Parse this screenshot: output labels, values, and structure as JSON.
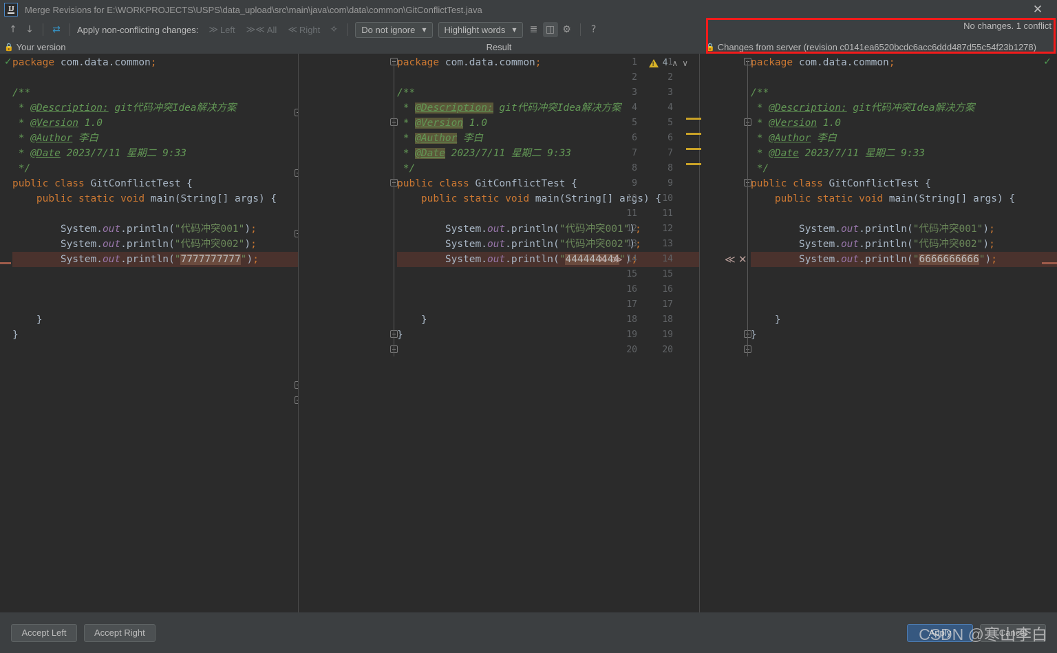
{
  "window": {
    "title": "Merge Revisions for E:\\WORKPROJECTS\\USPS\\data_upload\\src\\main\\java\\com\\data\\common\\GitConflictTest.java",
    "logo_text": "IJ",
    "close_label": "✕"
  },
  "toolbar": {
    "prev_label": "↑",
    "next_label": "↓",
    "magic_label": "⇄",
    "apply_label": "Apply non-conflicting changes:",
    "apply_left": "Left",
    "apply_all": "All",
    "apply_right": "Right",
    "magic_resolve_label": "✨",
    "ignore_combo": "Do not ignore",
    "highlight_combo": "Highlight words",
    "collapse_icon": "≡",
    "columns_icon": "▥",
    "gear_icon": "⚙",
    "help_icon": "?"
  },
  "panes": {
    "left_title": "Your version",
    "center_title": "Result",
    "right_title": "Changes from server (revision c0141ea6520bcdc6acc6ddd487d55c54f23b1278)",
    "lock_glyph": "🔒",
    "status": "No changes. 1 conflict",
    "warning_count": "4",
    "warn_up": "∧",
    "warn_down": "∨",
    "check_glyph": "✓"
  },
  "conflict": {
    "left_reject": "✕",
    "left_accept": "≫",
    "right_accept": "≪",
    "right_reject": "✕"
  },
  "code": {
    "left_lines": [
      {
        "n": 1,
        "tokens": [
          [
            "kw",
            "package"
          ],
          [
            "plain",
            " com.data.common"
          ],
          [
            "semi",
            ";"
          ]
        ]
      },
      {
        "n": 2,
        "tokens": []
      },
      {
        "n": 3,
        "tokens": [
          [
            "cmt",
            "/**"
          ]
        ]
      },
      {
        "n": 4,
        "tokens": [
          [
            "cmt",
            " * "
          ],
          [
            "tag",
            "@Description:"
          ],
          [
            "cmt",
            " git代码冲突Idea解决方案"
          ]
        ]
      },
      {
        "n": 5,
        "tokens": [
          [
            "cmt",
            " * "
          ],
          [
            "tag",
            "@Version"
          ],
          [
            "cmt",
            " 1.0"
          ]
        ]
      },
      {
        "n": 6,
        "tokens": [
          [
            "cmt",
            " * "
          ],
          [
            "tag",
            "@Author"
          ],
          [
            "cmt",
            " 李白"
          ]
        ]
      },
      {
        "n": 7,
        "tokens": [
          [
            "cmt",
            " * "
          ],
          [
            "tag",
            "@Date"
          ],
          [
            "cmt",
            " 2023/7/11 星期二 9:33"
          ]
        ]
      },
      {
        "n": 8,
        "tokens": [
          [
            "cmt",
            " */"
          ]
        ]
      },
      {
        "n": 9,
        "tokens": [
          [
            "kw",
            "public class "
          ],
          [
            "cls",
            "GitConflictTest"
          ],
          [
            "plain",
            " {"
          ]
        ]
      },
      {
        "n": 10,
        "tokens": [
          [
            "plain",
            "    "
          ],
          [
            "kw",
            "public static void "
          ],
          [
            "cls",
            "main"
          ],
          [
            "plain",
            "("
          ],
          [
            "cls",
            "String"
          ],
          [
            "plain",
            "[] args) {"
          ]
        ]
      },
      {
        "n": 11,
        "tokens": []
      },
      {
        "n": 12,
        "tokens": [
          [
            "plain",
            "        System."
          ],
          [
            "stat",
            "out"
          ],
          [
            "plain",
            ".println("
          ],
          [
            "str",
            "\"代码冲突001\""
          ],
          [
            "plain",
            ")"
          ],
          [
            "semi",
            ";"
          ]
        ]
      },
      {
        "n": 13,
        "tokens": [
          [
            "plain",
            "        System."
          ],
          [
            "stat",
            "out"
          ],
          [
            "plain",
            ".println("
          ],
          [
            "str",
            "\"代码冲突002\""
          ],
          [
            "plain",
            ")"
          ],
          [
            "semi",
            ";"
          ]
        ]
      },
      {
        "n": 14,
        "tokens": [
          [
            "plain",
            "        System."
          ],
          [
            "stat",
            "out"
          ],
          [
            "plain",
            ".println("
          ],
          [
            "str",
            "\""
          ],
          [
            "strbg",
            "7777777777"
          ],
          [
            "str",
            "\""
          ],
          [
            "plain",
            ")"
          ],
          [
            "semi",
            ";"
          ]
        ],
        "conflict": true
      },
      {
        "n": 15,
        "tokens": []
      },
      {
        "n": 16,
        "tokens": []
      },
      {
        "n": 17,
        "tokens": []
      },
      {
        "n": 18,
        "tokens": [
          [
            "plain",
            "    }"
          ]
        ]
      },
      {
        "n": 19,
        "tokens": [
          [
            "plain",
            "}"
          ]
        ]
      },
      {
        "n": 20,
        "tokens": []
      }
    ],
    "center_lines": [
      {
        "n": 1,
        "tokens": [
          [
            "kw",
            "package"
          ],
          [
            "plain",
            " com.data.common"
          ],
          [
            "semi",
            ";"
          ]
        ]
      },
      {
        "n": 2,
        "tokens": []
      },
      {
        "n": 3,
        "tokens": [
          [
            "cmt",
            "/**"
          ]
        ]
      },
      {
        "n": 4,
        "tokens": [
          [
            "cmt",
            " * "
          ],
          [
            "tagbg-tag",
            "@Description:"
          ],
          [
            "cmt",
            " git代码冲突Idea解决方案"
          ]
        ]
      },
      {
        "n": 5,
        "tokens": [
          [
            "cmt",
            " * "
          ],
          [
            "tagbg-tag",
            "@Version"
          ],
          [
            "cmt",
            " 1.0"
          ]
        ]
      },
      {
        "n": 6,
        "tokens": [
          [
            "cmt",
            " * "
          ],
          [
            "tagbg-tag",
            "@Author"
          ],
          [
            "cmt",
            " 李白"
          ]
        ]
      },
      {
        "n": 7,
        "tokens": [
          [
            "cmt",
            " * "
          ],
          [
            "tagbg-tag",
            "@Date"
          ],
          [
            "cmt",
            " 2023/7/11 星期二 9:33"
          ]
        ]
      },
      {
        "n": 8,
        "tokens": [
          [
            "cmt",
            " */"
          ]
        ]
      },
      {
        "n": 9,
        "tokens": [
          [
            "kw",
            "public class "
          ],
          [
            "cls",
            "GitConflictTest"
          ],
          [
            "plain",
            " {"
          ]
        ]
      },
      {
        "n": 10,
        "tokens": [
          [
            "plain",
            "    "
          ],
          [
            "kw",
            "public static void "
          ],
          [
            "cls",
            "main"
          ],
          [
            "plain",
            "("
          ],
          [
            "cls",
            "String"
          ],
          [
            "plain",
            "[] args) {"
          ]
        ]
      },
      {
        "n": 11,
        "tokens": []
      },
      {
        "n": 12,
        "tokens": [
          [
            "plain",
            "        System."
          ],
          [
            "stat",
            "out"
          ],
          [
            "plain",
            ".println("
          ],
          [
            "str",
            "\"代码冲突001\""
          ],
          [
            "plain",
            ")"
          ],
          [
            "semi",
            ";"
          ]
        ]
      },
      {
        "n": 13,
        "tokens": [
          [
            "plain",
            "        System."
          ],
          [
            "stat",
            "out"
          ],
          [
            "plain",
            ".println("
          ],
          [
            "str",
            "\"代码冲突002\""
          ],
          [
            "plain",
            ")"
          ],
          [
            "semi",
            ";"
          ]
        ]
      },
      {
        "n": 14,
        "tokens": [
          [
            "plain",
            "        System."
          ],
          [
            "stat",
            "out"
          ],
          [
            "plain",
            ".println("
          ],
          [
            "str",
            "\""
          ],
          [
            "strbg",
            "444444444"
          ],
          [
            "str",
            "\""
          ],
          [
            "plain",
            ")"
          ],
          [
            "semi",
            ";"
          ]
        ],
        "conflict": true
      },
      {
        "n": 15,
        "tokens": []
      },
      {
        "n": 16,
        "tokens": []
      },
      {
        "n": 17,
        "tokens": []
      },
      {
        "n": 18,
        "tokens": [
          [
            "plain",
            "    }"
          ]
        ]
      },
      {
        "n": 19,
        "tokens": [
          [
            "plain",
            "}"
          ]
        ]
      },
      {
        "n": 20,
        "tokens": []
      }
    ],
    "right_lines": [
      {
        "n": 1,
        "tokens": [
          [
            "kw",
            "package"
          ],
          [
            "plain",
            " com.data.common"
          ],
          [
            "semi",
            ";"
          ]
        ]
      },
      {
        "n": 2,
        "tokens": []
      },
      {
        "n": 3,
        "tokens": [
          [
            "cmt",
            "/**"
          ]
        ]
      },
      {
        "n": 4,
        "tokens": [
          [
            "cmt",
            " * "
          ],
          [
            "tag",
            "@Description:"
          ],
          [
            "cmt",
            " git代码冲突Idea解决方案"
          ]
        ]
      },
      {
        "n": 5,
        "tokens": [
          [
            "cmt",
            " * "
          ],
          [
            "tag",
            "@Version"
          ],
          [
            "cmt",
            " 1.0"
          ]
        ]
      },
      {
        "n": 6,
        "tokens": [
          [
            "cmt",
            " * "
          ],
          [
            "tag",
            "@Author"
          ],
          [
            "cmt",
            " 李白"
          ]
        ]
      },
      {
        "n": 7,
        "tokens": [
          [
            "cmt",
            " * "
          ],
          [
            "tag",
            "@Date"
          ],
          [
            "cmt",
            " 2023/7/11 星期二 9:33"
          ]
        ]
      },
      {
        "n": 8,
        "tokens": [
          [
            "cmt",
            " */"
          ]
        ]
      },
      {
        "n": 9,
        "tokens": [
          [
            "kw",
            "public class "
          ],
          [
            "cls",
            "GitConflictTest"
          ],
          [
            "plain",
            " {"
          ]
        ]
      },
      {
        "n": 10,
        "tokens": [
          [
            "plain",
            "    "
          ],
          [
            "kw",
            "public static void "
          ],
          [
            "cls",
            "main"
          ],
          [
            "plain",
            "("
          ],
          [
            "cls",
            "String"
          ],
          [
            "plain",
            "[] args) {"
          ]
        ]
      },
      {
        "n": 11,
        "tokens": []
      },
      {
        "n": 12,
        "tokens": [
          [
            "plain",
            "        System."
          ],
          [
            "stat",
            "out"
          ],
          [
            "plain",
            ".println("
          ],
          [
            "str",
            "\"代码冲突001\""
          ],
          [
            "plain",
            ")"
          ],
          [
            "semi",
            ";"
          ]
        ]
      },
      {
        "n": 13,
        "tokens": [
          [
            "plain",
            "        System."
          ],
          [
            "stat",
            "out"
          ],
          [
            "plain",
            ".println("
          ],
          [
            "str",
            "\"代码冲突002\""
          ],
          [
            "plain",
            ")"
          ],
          [
            "semi",
            ";"
          ]
        ]
      },
      {
        "n": 14,
        "tokens": [
          [
            "plain",
            "        System."
          ],
          [
            "stat",
            "out"
          ],
          [
            "plain",
            ".println("
          ],
          [
            "str",
            "\""
          ],
          [
            "strbg",
            "6666666666"
          ],
          [
            "str",
            "\""
          ],
          [
            "plain",
            ")"
          ],
          [
            "semi",
            ";"
          ]
        ],
        "conflict": true
      },
      {
        "n": 15,
        "tokens": []
      },
      {
        "n": 16,
        "tokens": []
      },
      {
        "n": 17,
        "tokens": []
      },
      {
        "n": 18,
        "tokens": [
          [
            "plain",
            "    }"
          ]
        ]
      },
      {
        "n": 19,
        "tokens": [
          [
            "plain",
            "}"
          ]
        ]
      },
      {
        "n": 20,
        "tokens": []
      }
    ]
  },
  "buttons": {
    "accept_left": "Accept Left",
    "accept_right": "Accept Right",
    "apply": "Apply",
    "cancel": "Cancel"
  },
  "watermark": {
    "text": "CSDN @寒山李白"
  },
  "colors": {
    "accent": "#365880",
    "conflict_row": "#4a322d",
    "warning": "#d9b427",
    "annotation": "#f31b1b",
    "editor_bg": "#2b2b2b",
    "chrome_bg": "#3c3f41"
  }
}
